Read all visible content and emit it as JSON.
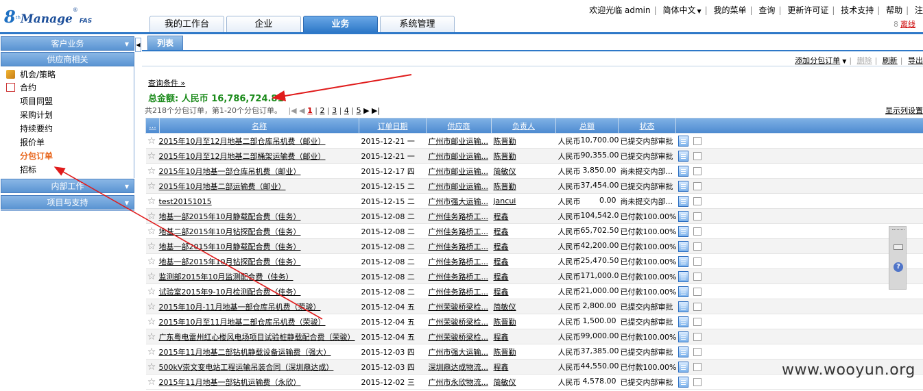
{
  "header": {
    "logo": {
      "mark": "8",
      "sup": "th",
      "name": "Manage",
      "suffix": "FAS"
    },
    "toplinks": [
      "欢迎光临 admin",
      "简体中文",
      "我的菜单",
      "查询",
      "更新许可证",
      "技术支持",
      "帮助",
      "注"
    ],
    "logout": "离线",
    "tabs": [
      "我的工作台",
      "企业",
      "业务",
      "系统管理"
    ],
    "active_tab": "业务"
  },
  "sidebar": {
    "sections": [
      "客户业务",
      "供应商相关",
      "内部工作",
      "项目与支持"
    ],
    "items": [
      "机会/策略",
      "合约",
      "项目同盟",
      "采购计划",
      "持续要约",
      "报价单",
      "分包订单",
      "招标"
    ],
    "active_item": "分包订单"
  },
  "content": {
    "subtab": "列表",
    "toolbar": {
      "add": "添加分包订单",
      "delete": "删除",
      "refresh": "刷新",
      "export": "导出"
    },
    "query_link": "查询条件 »",
    "total": "总金额: 人民币  16,786,724.81",
    "pager": {
      "summary": "共218个分包订单，第1-20个分包订单。",
      "pages": [
        "1",
        "2",
        "3",
        "4",
        "5"
      ],
      "current": "1"
    },
    "column_settings": "显示列设置",
    "columns": [
      "...",
      "名称",
      "订单日期",
      "供应商",
      "负责人",
      "总额",
      "状态"
    ],
    "rows": [
      {
        "name": "2015年10月至12月地基二部仓库吊机费（邮业）",
        "date": "2015-12-21 一",
        "supplier": "广州市邮业运输...",
        "owner": "陈晋勤",
        "cur": "人民币",
        "amount": "10,700.00",
        "status": "已提交内部审批"
      },
      {
        "name": "2015年10月至12月地基二部桶架运输费（邮业）",
        "date": "2015-12-21 一",
        "supplier": "广州市邮业运输...",
        "owner": "陈晋勤",
        "cur": "人民币",
        "amount": "90,355.00",
        "status": "已提交内部审批"
      },
      {
        "name": "2015年10月地基一部仓库吊机费（邮业）",
        "date": "2015-12-17 四",
        "supplier": "广州市邮业运输...",
        "owner": "简敏仪",
        "cur": "人民币",
        "amount": "3,850.00",
        "status": "尚未提交内部..."
      },
      {
        "name": "2015年10月地基二部运输费（邮业）",
        "date": "2015-12-15 二",
        "supplier": "广州市邮业运输...",
        "owner": "陈晋勤",
        "cur": "人民币",
        "amount": "37,454.00",
        "status": "已提交内部审批"
      },
      {
        "name": "test20151015",
        "date": "2015-12-15 二",
        "supplier": "广州市强大运输...",
        "owner": "jancui",
        "cur": "人民币",
        "amount": "0.00",
        "status": "尚未提交内部..."
      },
      {
        "name": "地基一部2015年10月静载配合费（佳务）",
        "date": "2015-12-08 二",
        "supplier": "广州佳务路桥工...",
        "owner": "程鑫",
        "cur": "人民币",
        "amount": "104,542.0",
        "status": "已付款100.00%"
      },
      {
        "name": "地基二部2015年10月钻探配合费（佳务）",
        "date": "2015-12-08 二",
        "supplier": "广州佳务路桥工...",
        "owner": "程鑫",
        "cur": "人民币",
        "amount": "65,702.50",
        "status": "已付款100.00%"
      },
      {
        "name": "地基一部2015年10月静载配合费（佳务）",
        "date": "2015-12-08 二",
        "supplier": "广州佳务路桥工...",
        "owner": "程鑫",
        "cur": "人民币",
        "amount": "42,200.00",
        "status": "已付款100.00%"
      },
      {
        "name": "地基一部2015年10月钻探配合费（佳务）",
        "date": "2015-12-08 二",
        "supplier": "广州佳务路桥工...",
        "owner": "程鑫",
        "cur": "人民币",
        "amount": "25,470.50",
        "status": "已付款100.00%"
      },
      {
        "name": "监测部2015年10月监测配合费（佳务）",
        "date": "2015-12-08 二",
        "supplier": "广州佳务路桥工...",
        "owner": "程鑫",
        "cur": "人民币",
        "amount": "171,000.0",
        "status": "已付款100.00%"
      },
      {
        "name": "试验室2015年9-10月检测配合费（佳务）",
        "date": "2015-12-08 二",
        "supplier": "广州佳务路桥工...",
        "owner": "程鑫",
        "cur": "人民币",
        "amount": "21,000.00",
        "status": "已付款100.00%"
      },
      {
        "name": "2015年10月-11月地基一部仓库吊机费（荣骏）",
        "date": "2015-12-04 五",
        "supplier": "广州荣骏桥梁检...",
        "owner": "简敏仪",
        "cur": "人民币",
        "amount": "2,800.00",
        "status": "已提交内部审批"
      },
      {
        "name": "2015年10月至11月地基二部仓库吊机费（荣骏）",
        "date": "2015-12-04 五",
        "supplier": "广州荣骏桥梁检...",
        "owner": "陈晋勤",
        "cur": "人民币",
        "amount": "1,500.00",
        "status": "已提交内部审批"
      },
      {
        "name": "广东粤电雷州红心楼风电场项目试验桩静载配合费（荣骏）",
        "date": "2015-12-04 五",
        "supplier": "广州荣骏桥梁检...",
        "owner": "程鑫",
        "cur": "人民币",
        "amount": "99,000.00",
        "status": "已付款100.00%"
      },
      {
        "name": "2015年11月地基二部钻机静载设备运输费（强大）",
        "date": "2015-12-03 四",
        "supplier": "广州市强大运输...",
        "owner": "陈晋勤",
        "cur": "人民币",
        "amount": "37,385.00",
        "status": "已提交内部审批"
      },
      {
        "name": "500kV崇文变电站工程运输吊装合同（深圳鼎达成）",
        "date": "2015-12-03 四",
        "supplier": "深圳鼎达成物流...",
        "owner": "程鑫",
        "cur": "人民币",
        "amount": "44,550.00",
        "status": "已付款100.00%"
      },
      {
        "name": "2015年11月地基一部钻机运输费（永欣）",
        "date": "2015-12-02 三",
        "supplier": "广州市永欣物流...",
        "owner": "简敏仪",
        "cur": "人民币",
        "amount": "4,578.00",
        "status": "已提交内部审批"
      }
    ]
  },
  "watermark": "www.wooyun.org",
  "colors": {
    "accent": "#2e78c8",
    "total_green": "#1a8a1a",
    "active_orange": "#e8661c",
    "annotation_red": "#e01b1b"
  }
}
